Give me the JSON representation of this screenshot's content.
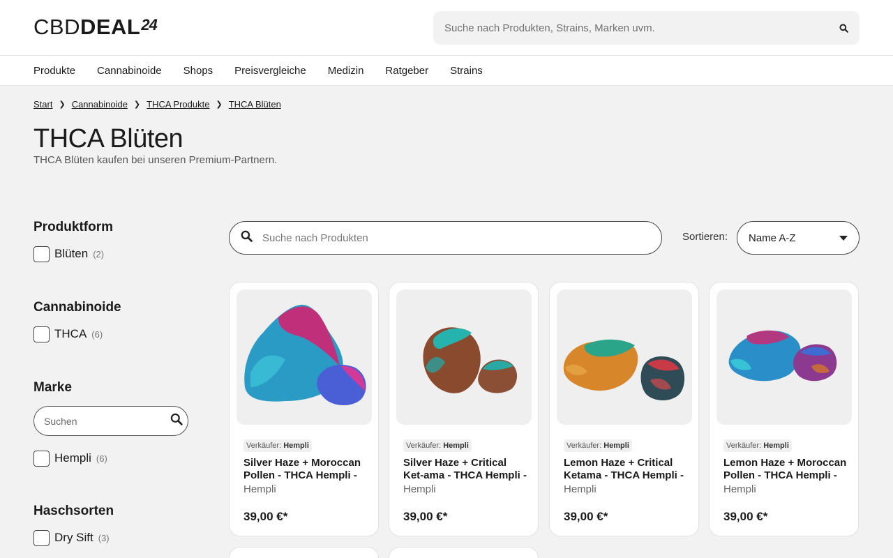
{
  "header": {
    "logo_light": "CBD",
    "logo_bold": "DEAL",
    "logo_sup": "24",
    "search_placeholder": "Suche nach Produkten, Strains, Marken uvm."
  },
  "nav": {
    "items": [
      "Produkte",
      "Cannabinoide",
      "Shops",
      "Preisvergleiche",
      "Medizin",
      "Ratgeber",
      "Strains"
    ]
  },
  "breadcrumb": [
    "Start",
    "Cannabinoide",
    "THCA Produkte",
    "THCA Blüten"
  ],
  "page": {
    "title": "THCA Blüten",
    "subtitle": "THCA Blüten kaufen bei unseren Premium-Partnern."
  },
  "filters": {
    "produktform": {
      "title": "Produktform",
      "options": [
        {
          "label": "Blüten",
          "count": "(2)"
        }
      ]
    },
    "cannabinoide": {
      "title": "Cannabinoide",
      "options": [
        {
          "label": "THCA",
          "count": "(6)"
        }
      ]
    },
    "marke": {
      "title": "Marke",
      "search_placeholder": "Suchen",
      "options": [
        {
          "label": "Hempli",
          "count": "(6)"
        }
      ]
    },
    "haschsorten": {
      "title": "Haschsorten",
      "options": [
        {
          "label": "Dry Sift",
          "count": "(3)"
        }
      ]
    }
  },
  "toolbar": {
    "search_placeholder": "Suche nach Produkten",
    "sort_label": "Sortieren:",
    "sort_value": "Name A-Z"
  },
  "products": [
    {
      "vendor_label": "Verkäufer:",
      "vendor": "Hempli",
      "name": "Silver Haze + Moroccan Pollen - THCA Hempli -",
      "brand": "Hempli",
      "price": "39,00 €*"
    },
    {
      "vendor_label": "Verkäufer:",
      "vendor": "Hempli",
      "name": "Silver Haze + Critical Ket-ama - THCA Hempli -",
      "brand": "Hempli",
      "price": "39,00 €*"
    },
    {
      "vendor_label": "Verkäufer:",
      "vendor": "Hempli",
      "name": "Lemon Haze + Critical Ketama - THCA Hempli -",
      "brand": "Hempli",
      "price": "39,00 €*"
    },
    {
      "vendor_label": "Verkäufer:",
      "vendor": "Hempli",
      "name": "Lemon Haze + Moroccan Pollen - THCA Hempli -",
      "brand": "Hempli",
      "price": "39,00 €*"
    }
  ],
  "colors": {
    "background": "#f2f2f2",
    "card": "#ffffff",
    "text": "#1a1a1a"
  }
}
